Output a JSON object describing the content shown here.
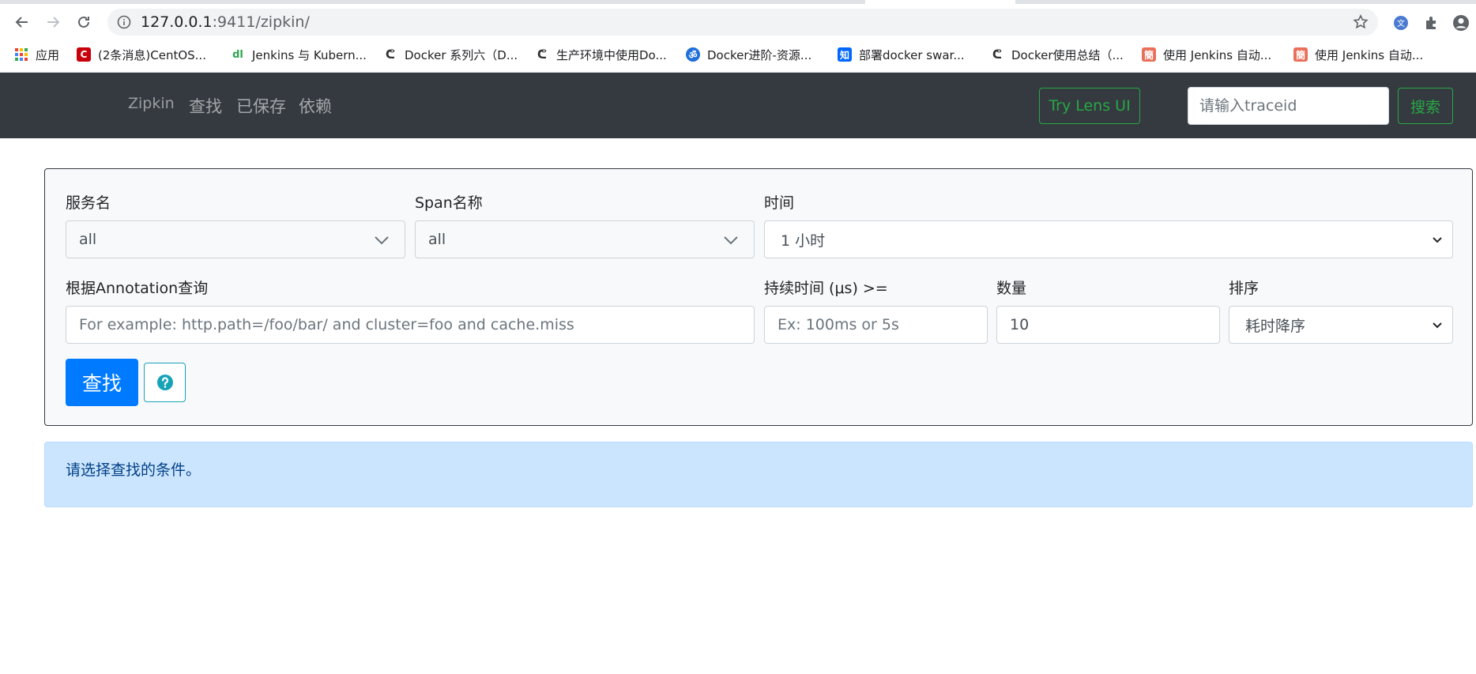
{
  "browser": {
    "url_host": "127.0.0.1",
    "url_rest": ":9411/zipkin/",
    "bookmarks": [
      {
        "label": "应用",
        "icon": "apps-grid-icon",
        "color": "#4285f4"
      },
      {
        "label": "(2条消息)CentOS...",
        "icon": "csdn-icon",
        "color": "#c7000b"
      },
      {
        "label": "Jenkins 与 Kubern...",
        "icon": "dlq-icon",
        "color": "#2da44e"
      },
      {
        "label": "Docker 系列六（D...",
        "icon": "fish-icon",
        "color": "#333333"
      },
      {
        "label": "生产环境中使用Do...",
        "icon": "fish-icon",
        "color": "#333333"
      },
      {
        "label": "Docker进阶-资源...",
        "icon": "om-icon",
        "color": "#1e6fd9"
      },
      {
        "label": "部署docker swar...",
        "icon": "zhihu-icon",
        "color": "#0066ff"
      },
      {
        "label": "Docker使用总结（...",
        "icon": "fish-icon",
        "color": "#333333"
      },
      {
        "label": "使用 Jenkins 自动...",
        "icon": "jianshu-icon",
        "color": "#ea6f5a"
      },
      {
        "label": "使用 Jenkins 自动...",
        "icon": "jianshu-icon",
        "color": "#ea6f5a"
      }
    ]
  },
  "navbar": {
    "brand": "Zipkin",
    "links": [
      "查找",
      "已保存",
      "依赖"
    ],
    "lens_button": "Try Lens UI",
    "trace_placeholder": "请输入traceid",
    "search_button": "搜索"
  },
  "form": {
    "service_label": "服务名",
    "service_value": "all",
    "span_label": "Span名称",
    "span_value": "all",
    "time_label": "时间",
    "time_value": "1 小时",
    "annotation_label": "根据Annotation查询",
    "annotation_placeholder": "For example: http.path=/foo/bar/ and cluster=foo and cache.miss",
    "duration_label": "持续时间 (μs) >=",
    "duration_placeholder": "Ex: 100ms or 5s",
    "limit_label": "数量",
    "limit_value": "10",
    "sort_label": "排序",
    "sort_value": "耗时降序",
    "find_button": "查找"
  },
  "alert": {
    "message": "请选择查找的条件。"
  },
  "colors": {
    "navbar_bg": "#343a40",
    "success": "#28a745",
    "primary": "#007bff",
    "info": "#17a2b8",
    "alert_bg": "#cce5ff",
    "alert_text": "#004085"
  }
}
